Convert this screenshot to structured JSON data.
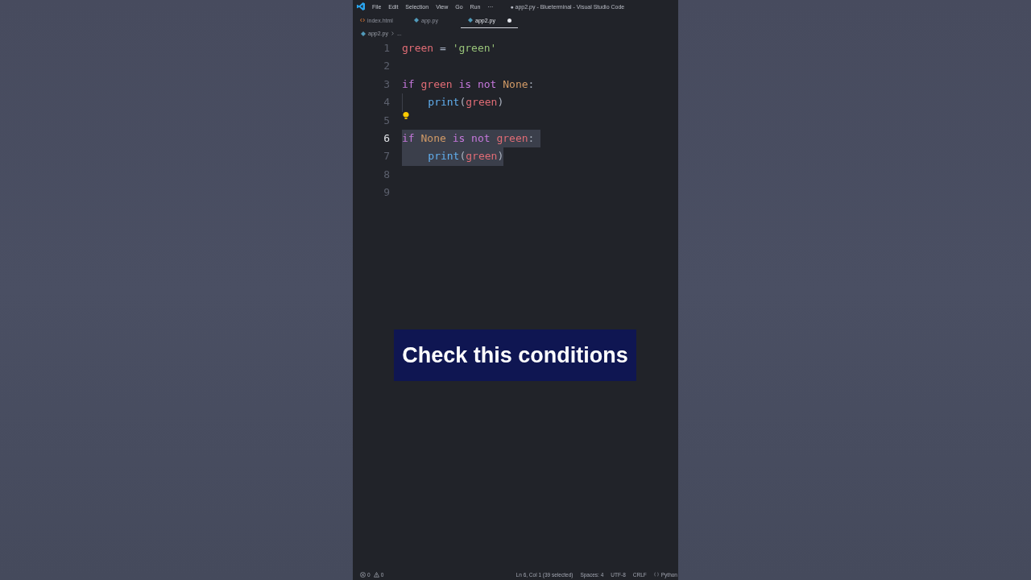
{
  "window": {
    "title": "● app2.py - Blueterminal - Visual Studio Code"
  },
  "menu": [
    "File",
    "Edit",
    "Selection",
    "View",
    "Go",
    "Run",
    "···"
  ],
  "tabs": [
    {
      "label": "index.html",
      "kind": "html",
      "selected": false,
      "modified": false
    },
    {
      "label": "app.py",
      "kind": "python",
      "selected": false,
      "modified": false
    },
    {
      "label": "app2.py",
      "kind": "python",
      "selected": true,
      "modified": true
    }
  ],
  "breadcrumb": {
    "kind": "python",
    "items": [
      "app2.py",
      "..."
    ]
  },
  "editor": {
    "lines": [
      {
        "number": "1",
        "current": false,
        "selected": false,
        "lightbulb": false,
        "tokens": [
          {
            "text": "green",
            "kind": "variable"
          },
          {
            "text": " = ",
            "kind": "operator"
          },
          {
            "text": "'green'",
            "kind": "string"
          }
        ]
      },
      {
        "number": "2",
        "current": false,
        "selected": false,
        "lightbulb": false
      },
      {
        "number": "3",
        "current": false,
        "selected": false,
        "lightbulb": false,
        "tokens": [
          {
            "text": "if ",
            "kind": "keyword"
          },
          {
            "text": "green ",
            "kind": "variable"
          },
          {
            "text": "is not ",
            "kind": "keyword"
          },
          {
            "text": "None",
            "kind": "constant"
          },
          {
            "text": ":",
            "kind": "punctuation"
          }
        ]
      },
      {
        "number": "4",
        "current": false,
        "selected": false,
        "lightbulb": false,
        "tokens": [
          {
            "text": "    print",
            "kind": "function"
          },
          {
            "text": "(",
            "kind": "punctuation"
          },
          {
            "text": "green",
            "kind": "variable"
          },
          {
            "text": ")",
            "kind": "punctuation"
          }
        ]
      },
      {
        "number": "5",
        "current": false,
        "selected": false,
        "lightbulb": true
      },
      {
        "number": "6",
        "current": true,
        "selected": true,
        "lightbulb": false,
        "tokens": [
          {
            "text": "if ",
            "kind": "keyword"
          },
          {
            "text": "None ",
            "kind": "constant"
          },
          {
            "text": "is not ",
            "kind": "keyword"
          },
          {
            "text": "green",
            "kind": "variable"
          },
          {
            "text": ":",
            "kind": "punctuation"
          }
        ]
      },
      {
        "number": "7",
        "current": false,
        "selected": true,
        "lightbulb": false,
        "tokens": [
          {
            "text": "    print",
            "kind": "function"
          },
          {
            "text": "(",
            "kind": "punctuation"
          },
          {
            "text": "green",
            "kind": "variable"
          },
          {
            "text": ")",
            "kind": "punctuation"
          }
        ]
      },
      {
        "number": "8",
        "current": false,
        "selected": false,
        "lightbulb": false
      },
      {
        "number": "9",
        "current": false,
        "selected": false,
        "lightbulb": false
      }
    ]
  },
  "caption": {
    "text": "Check this conditions"
  },
  "status_bar": {
    "errors": "0",
    "warnings": "0",
    "items": [
      "Ln 6, Col 1 (39 selected)",
      "Spaces: 4",
      "UTF-8",
      "CRLF"
    ],
    "language": "Python"
  }
}
